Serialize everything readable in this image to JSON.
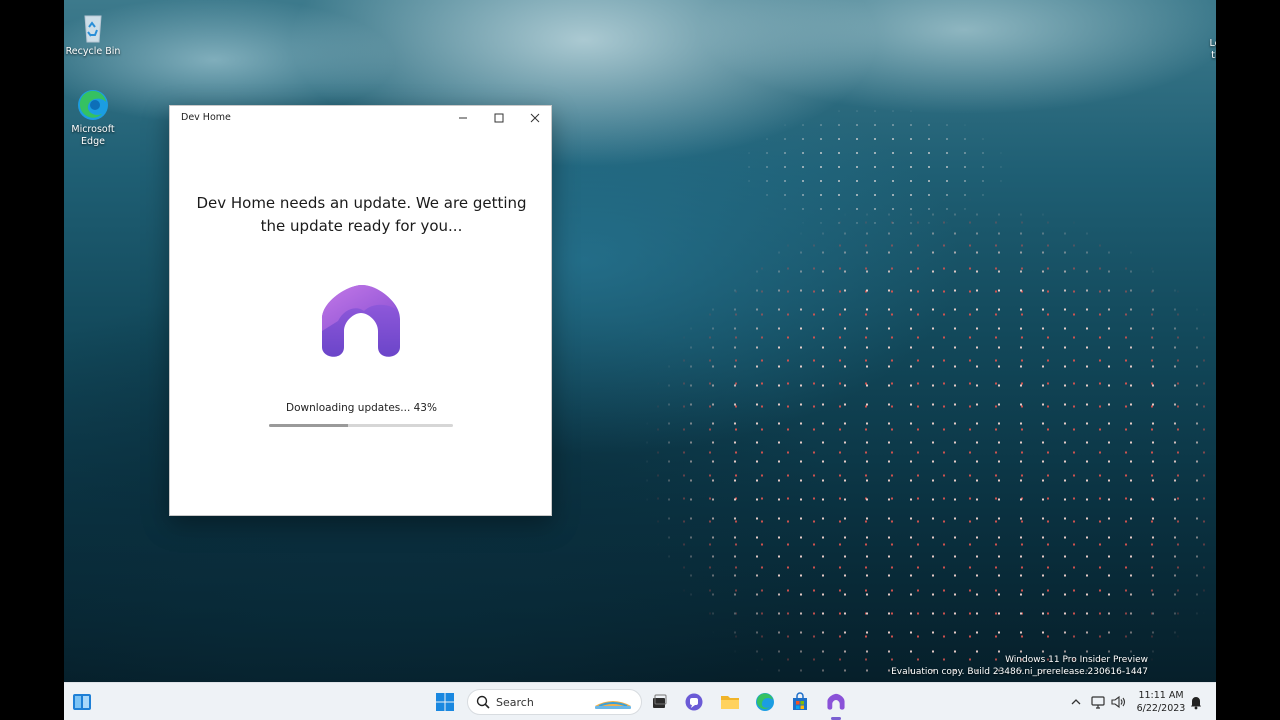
{
  "desktop": {
    "icons": [
      {
        "label": "Recycle Bin"
      },
      {
        "label": "Microsoft Edge"
      }
    ],
    "learn_label": "Learn about this picture",
    "watermark_line1": "Windows 11 Pro Insider Preview",
    "watermark_line2": "Evaluation copy. Build 23486.ni_prerelease.230616-1447"
  },
  "window": {
    "title": "Dev Home",
    "heading": "Dev Home needs an update. We are getting the update ready for you...",
    "status": "Downloading updates... 43%",
    "progress_percent": 43
  },
  "taskbar": {
    "search_label": "Search",
    "time": "11:11 AM",
    "date": "6/22/2023"
  }
}
